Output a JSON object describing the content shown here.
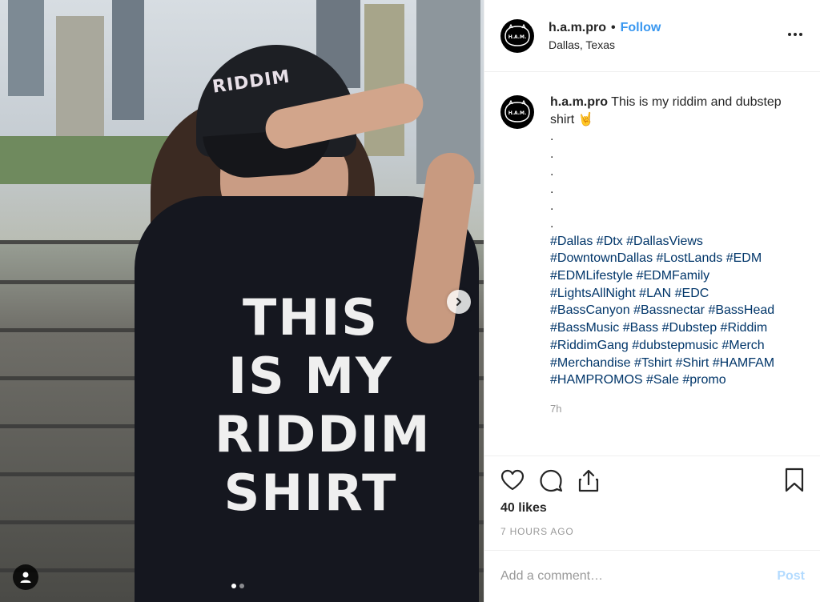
{
  "post": {
    "image_alt_logo_text": "RIDDIM",
    "shirt_text": "THIS IS MY RIDDIM SHIRT",
    "carousel": {
      "count": 2,
      "active": 1
    }
  },
  "header": {
    "username": "h.a.m.pro",
    "separator": "•",
    "follow_label": "Follow",
    "location": "Dallas, Texas",
    "avatar_text": "H.A.M."
  },
  "caption": {
    "username": "h.a.m.pro",
    "text": "This is my riddim and dubstep shirt 🤘",
    "dots": [
      ".",
      ".",
      ".",
      ".",
      ".",
      "."
    ],
    "hashtags": "#Dallas #Dtx #DallasViews #DowntownDallas #LostLands #EDM #EDMLifestyle #EDMFamily #LightsAllNight #LAN #EDC #BassCanyon #Bassnectar #BassHead #BassMusic #Bass #Dubstep #Riddim #RiddimGang #dubstepmusic #Merch #Merchandise #Tshirt #Shirt #HAMFAM #HAMPROMOS #Sale #promo",
    "time": "7h"
  },
  "actions": {
    "likes": "40 likes",
    "time_ago": "7 HOURS AGO",
    "icons": [
      "heart-icon",
      "comment-icon",
      "share-icon",
      "bookmark-icon"
    ]
  },
  "comment": {
    "placeholder": "Add a comment…",
    "post_label": "Post"
  },
  "colors": {
    "follow": "#3897f0",
    "hashtag": "#003569",
    "post_disabled": "#b3dbff",
    "muted": "#999999"
  }
}
